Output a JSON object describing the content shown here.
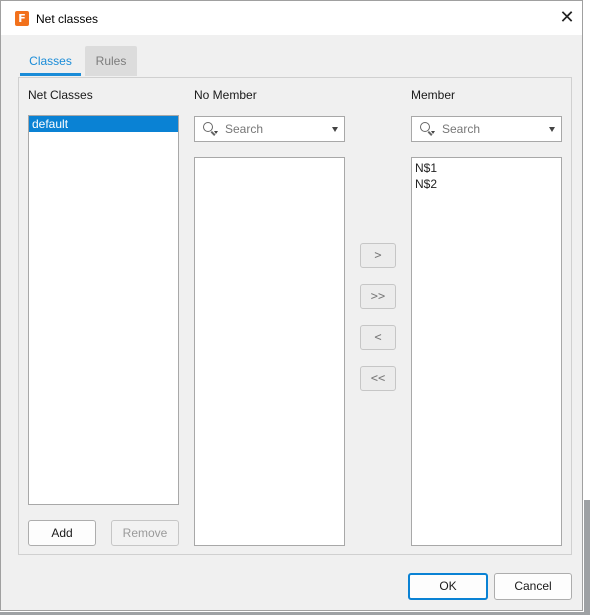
{
  "window": {
    "title": "Net classes",
    "app_icon_letter": "F",
    "close_glyph": "✕"
  },
  "tabs": [
    {
      "label": "Classes",
      "active": true
    },
    {
      "label": "Rules",
      "active": false
    }
  ],
  "net_classes": {
    "label": "Net Classes",
    "items": [
      {
        "label": "default",
        "selected": true
      }
    ],
    "add_label": "Add",
    "remove_label": "Remove"
  },
  "no_member": {
    "label": "No Member",
    "search_placeholder": "Search",
    "items": []
  },
  "member": {
    "label": "Member",
    "search_placeholder": "Search",
    "items": [
      {
        "label": "N$1"
      },
      {
        "label": "N$2"
      }
    ]
  },
  "transfer_buttons": {
    "add_one": ">",
    "add_all": ">>",
    "remove_one": "<",
    "remove_all": "<<"
  },
  "footer": {
    "ok_label": "OK",
    "cancel_label": "Cancel"
  },
  "colors": {
    "accent": "#0a82d4",
    "tab_active": "#1a8cd8",
    "app_icon": "#f2711c"
  }
}
